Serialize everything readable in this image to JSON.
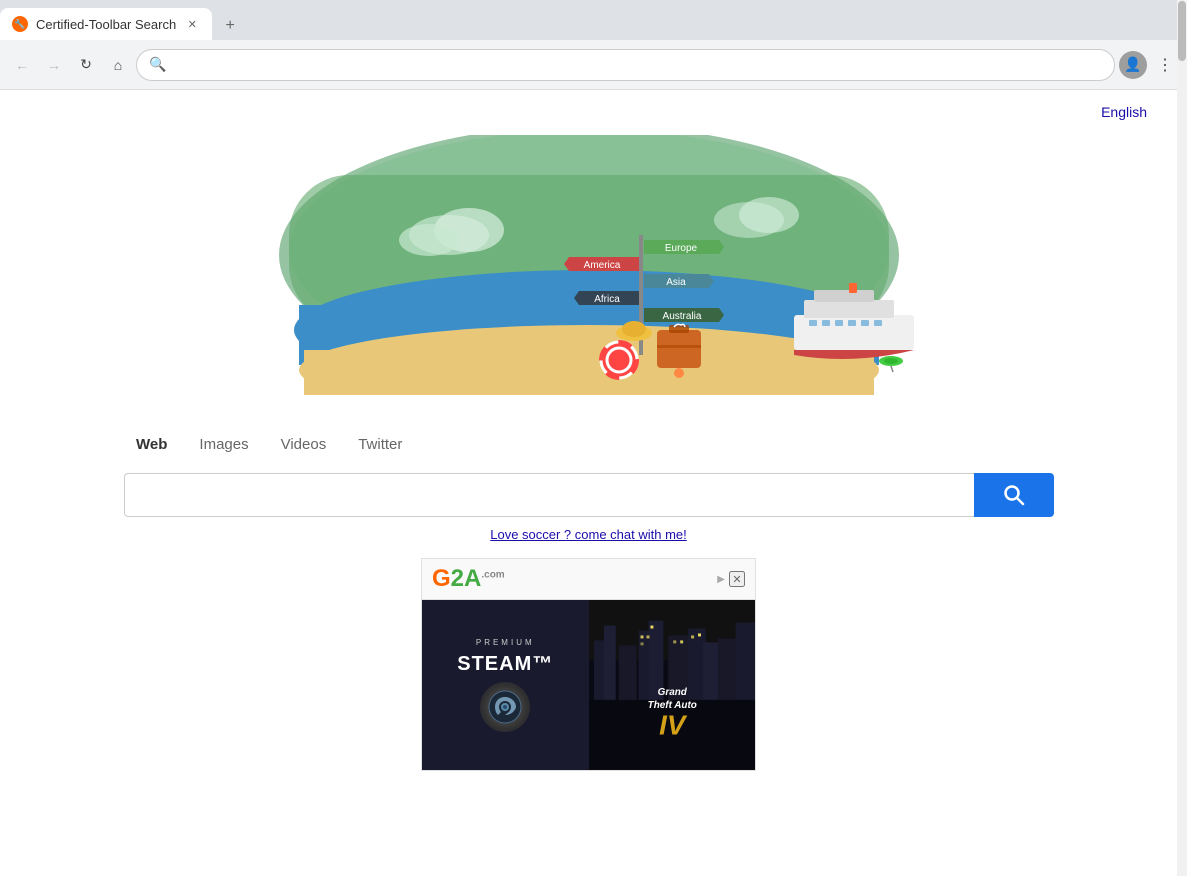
{
  "browser": {
    "tab": {
      "title": "Certified-Toolbar Search",
      "icon": "🔧"
    },
    "address_bar": {
      "value": "",
      "placeholder": ""
    }
  },
  "page": {
    "lang_link": "English",
    "search_tabs": [
      {
        "label": "Web",
        "active": true
      },
      {
        "label": "Images",
        "active": false
      },
      {
        "label": "Videos",
        "active": false
      },
      {
        "label": "Twitter",
        "active": false
      }
    ],
    "search_placeholder": "",
    "promo_link": "Love soccer ? come chat with me!",
    "ad": {
      "brand": "G2A",
      "brand_com": ".com",
      "left_premium": "PREMIUM",
      "left_logo": "STEAM™",
      "right_title_grand": "Grand",
      "right_title_theft": "Theft",
      "right_title_auto": "Auto",
      "right_title_num": "IV"
    }
  }
}
